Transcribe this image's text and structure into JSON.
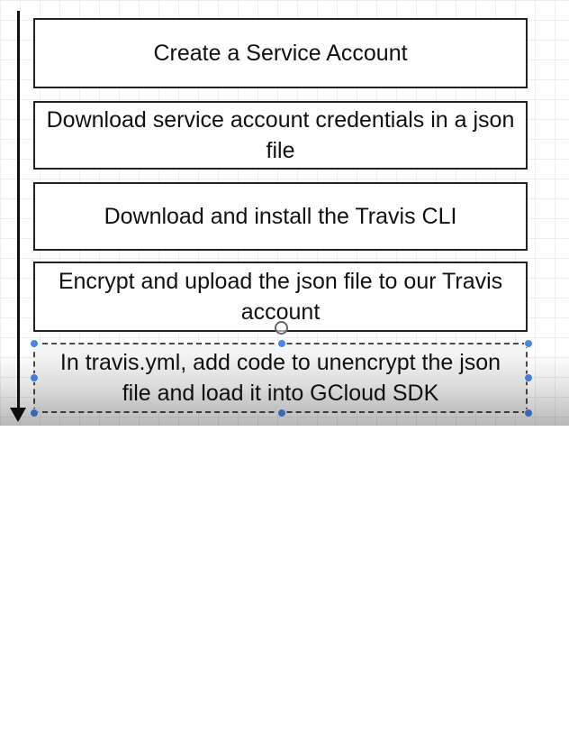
{
  "diagram": {
    "steps": [
      {
        "label": "Create a Service Account"
      },
      {
        "label": "Download service account credentials in a json file"
      },
      {
        "label": "Download and install the Travis CLI"
      },
      {
        "label": "Encrypt and upload the json file to our Travis account"
      },
      {
        "label": "In travis.yml, add code to unencrypt the json file and load it into GCloud SDK"
      }
    ],
    "selection_color": "#4a86e8",
    "line_color": "#111111"
  }
}
